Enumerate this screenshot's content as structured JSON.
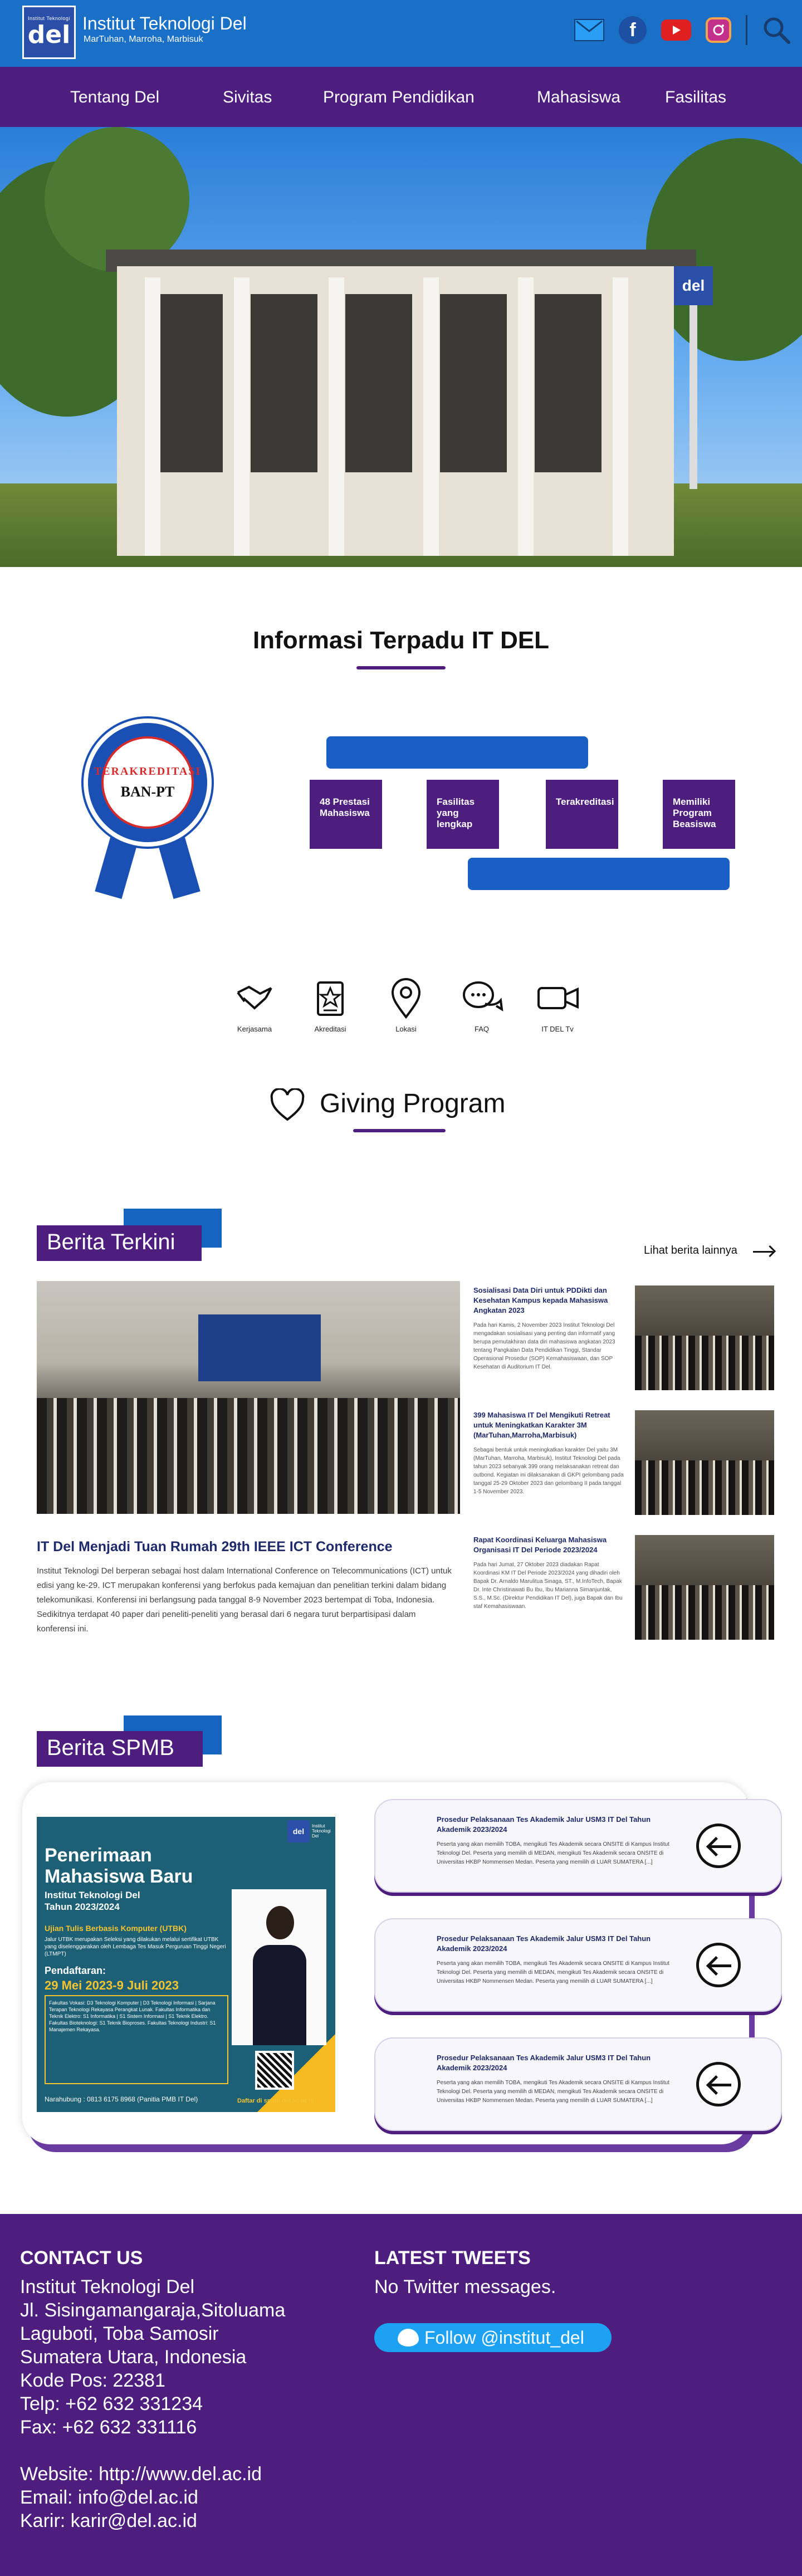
{
  "brand": {
    "logo_mini": "Institut Teknologi",
    "logo_text": "del",
    "name": "Institut Teknologi Del",
    "tagline": "MarTuhan, Marroha, Marbisuk"
  },
  "header_icons": [
    "mail-icon",
    "facebook-icon",
    "youtube-icon",
    "instagram-icon",
    "search-icon"
  ],
  "nav": [
    "Tentang Del",
    "Sivitas",
    "Program Pendidikan",
    "Mahasiswa",
    "Fasilitas"
  ],
  "hero": {
    "sign_text": "del"
  },
  "info": {
    "title": "Informasi Terpadu IT DEL",
    "badge": {
      "top": "TERAKREDITASI",
      "bottom": "BAN-PT"
    },
    "stats": [
      "48 Prestasi Mahasiswa",
      "Fasilitas yang lengkap",
      "Terakreditasi",
      "Memiliki Program Beasiswa"
    ],
    "quick_links": [
      "Kerjasama",
      "Akreditasi",
      "Lokasi",
      "FAQ",
      "IT DEL Tv"
    ],
    "giving": "Giving Program"
  },
  "berita": {
    "heading": "Berita Terkini",
    "more": "Lihat berita lainnya",
    "main": {
      "headline": "IT Del Menjadi Tuan Rumah 29th IEEE ICT Conference",
      "body": "Institut Teknologi Del berperan sebagai host dalam International Conference on Telecommunications (ICT) untuk edisi yang ke-29. ICT merupakan konferensi yang berfokus pada kemajuan dan penelitian terkini dalam bidang telekomunikasi. Konferensi ini berlangsung pada tanggal 8-9 November 2023 bertempat di Toba, Indonesia. Sedikitnya terdapat 40 paper dari peneliti-peneliti yang berasal dari 6 negara turut berpartisipasi dalam konferensi ini."
    },
    "side": [
      {
        "title": "Sosialisasi Data Diri untuk PDDikti dan Kesehatan Kampus kepada Mahasiswa Angkatan 2023",
        "body": "Pada hari Kamis, 2 November 2023 Institut Teknologi Del mengadakan sosialisasi yang penting dan informatif yang berupa pemutakhiran data diri mahasiswa angkatan 2023 tentang Pangkalan Data Pendidikan Tinggi, Standar Operasional Prosedur (SOP) Kemahasiswaan, dan SOP Kesehatan di Auditorium IT Del."
      },
      {
        "title": "399 Mahasiswa IT Del Mengikuti Retreat untuk Meningkatkan Karakter 3M (MarTuhan,Marroha,Marbisuk)",
        "body": "Sebagai bentuk untuk meningkatkan karakter Del yaitu 3M (MarTuhan, Marroha, Marbisuk), Institut Teknologi Del pada tahun 2023 sebanyak 399 orang melaksanakan retreat dan outbond. Kegiatan ini dilaksanakan di GKPI gelombang pada tanggal 25-29 Oktober 2023 dan gelombang II pada tanggal 1-5 November 2023."
      },
      {
        "title": "Rapat Koordinasi Keluarga Mahasiswa Organisasi IT Del Periode 2023/2024",
        "body": "Pada hari Jumat, 27 Oktober 2023 diadakan Rapat Koordinasi KM IT Del Periode 2023/2024 yang dihadiri oleh Bapak Dr. Arnaldo Marulitua Sinaga, ST., M.InfoTech, Bapak Dr. Inte Christinawati Bu Ibu, Ibu Marianna Simanjuntak, S.S., M.Sc. (Direktur Pendidikan IT Del), juga Bapak dan Ibu staf Kemahasiswaan."
      }
    ]
  },
  "spmb": {
    "heading": "Berita SPMB",
    "poster": {
      "logo": "del",
      "logo_caption": "Institut Teknologi Del",
      "line1": "Penerimaan",
      "line2": "Mahasiswa Baru",
      "sub1": "Institut Teknologi Del",
      "sub2": "Tahun 2023/2024",
      "exam": "Ujian Tulis Berbasis Komputer (UTBK)",
      "exam_desc": "Jalur UTBK merupakan Seleksi yang dilakukan melalui sertifikat UTBK yang diselenggarakan oleh Lembaga Tes Masuk Perguruan Tinggi Negeri (LTMPT)",
      "reg": "Pendaftaran:",
      "date": "29 Mei 2023-9 Juli 2023",
      "faculties": "Fakultas Vokasi: D3 Teknologi Komputer | D3 Teknologi Informasi | Sarjana Terapan Teknologi Rekayasa Perangkat Lunak. Fakultas Informatika dan Teknik Elektro: S1 Informatika | S1 Sistem Informasi | S1 Teknik Elektro. Fakultas Bioteknologi: S1 Teknik Bioproses. Fakultas Teknologi Industri: S1 Manajemen Rekayasa.",
      "contact": "Narahubung : 0813 6175 8968 (Panitia PMB IT Del)",
      "site": "Daftar di spmb.del.ac.id !!!"
    },
    "items": [
      {
        "title": "Prosedur Pelaksanaan Tes Akademik Jalur USM3 IT Del Tahun Akademik 2023/2024",
        "body": "Peserta yang akan memilih TOBA, mengikuti Tes Akademik secara ONSITE di Kampus Institut Teknologi Del. Peserta yang memilih di MEDAN, mengikuti Tes Akademik secara ONSITE di Universitas HKBP Nommensen Medan. Peserta yang memilih di LUAR SUMATERA [...]"
      },
      {
        "title": "Prosedur Pelaksanaan Tes Akademik Jalur USM3 IT Del Tahun Akademik 2023/2024",
        "body": "Peserta yang akan memilih TOBA, mengikuti Tes Akademik secara ONSITE di Kampus Institut Teknologi Del. Peserta yang memilih di MEDAN, mengikuti Tes Akademik secara ONSITE di Universitas HKBP Nommensen Medan. Peserta yang memilih di LUAR SUMATERA [...]"
      },
      {
        "title": "Prosedur Pelaksanaan Tes Akademik Jalur USM3 IT Del Tahun Akademik 2023/2024",
        "body": "Peserta yang akan memilih TOBA, mengikuti Tes Akademik secara ONSITE di Kampus Institut Teknologi Del. Peserta yang memilih di MEDAN, mengikuti Tes Akademik secara ONSITE di Universitas HKBP Nommensen Medan. Peserta yang memilih di LUAR SUMATERA [...]"
      }
    ]
  },
  "footer": {
    "contact_title": "CONTACT US",
    "contact_lines": [
      "Institut Teknologi Del",
      "Jl. Sisingamangaraja,Sitoluama",
      "Laguboti, Toba Samosir",
      "Sumatera Utara, Indonesia",
      "Kode Pos: 22381",
      "Telp: +62 632 331234",
      "Fax: +62 632 331116",
      "",
      "Website: http://www.del.ac.id",
      "Email: info@del.ac.id",
      "Karir: karir@del.ac.id"
    ],
    "tweets_title": "LATEST TWEETS",
    "tweets_empty": "No Twitter messages.",
    "follow": "Follow @institut_del"
  },
  "colors": {
    "topbar": "#1a6fc6",
    "purple": "#4d1e7e",
    "blue": "#1565c0",
    "twitter": "#1da1f2"
  }
}
